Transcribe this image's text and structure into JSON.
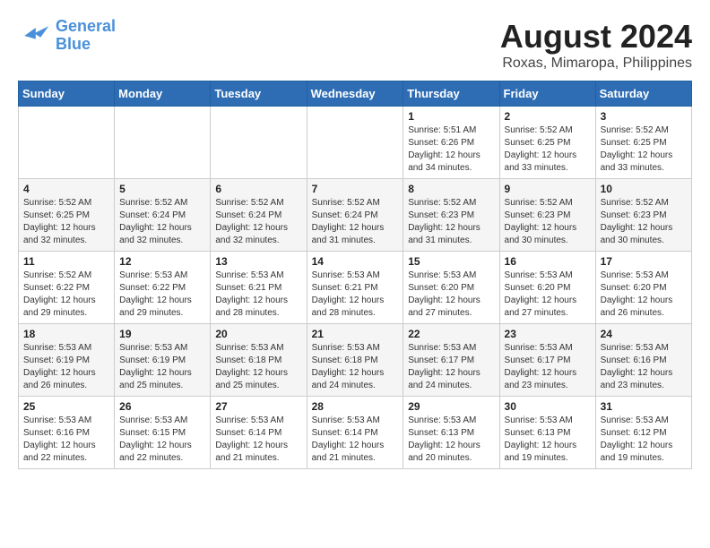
{
  "logo": {
    "line1": "General",
    "line2": "Blue"
  },
  "title": "August 2024",
  "subtitle": "Roxas, Mimaropa, Philippines",
  "days_of_week": [
    "Sunday",
    "Monday",
    "Tuesday",
    "Wednesday",
    "Thursday",
    "Friday",
    "Saturday"
  ],
  "weeks": [
    [
      {
        "day": "",
        "info": ""
      },
      {
        "day": "",
        "info": ""
      },
      {
        "day": "",
        "info": ""
      },
      {
        "day": "",
        "info": ""
      },
      {
        "day": "1",
        "info": "Sunrise: 5:51 AM\nSunset: 6:26 PM\nDaylight: 12 hours\nand 34 minutes."
      },
      {
        "day": "2",
        "info": "Sunrise: 5:52 AM\nSunset: 6:25 PM\nDaylight: 12 hours\nand 33 minutes."
      },
      {
        "day": "3",
        "info": "Sunrise: 5:52 AM\nSunset: 6:25 PM\nDaylight: 12 hours\nand 33 minutes."
      }
    ],
    [
      {
        "day": "4",
        "info": "Sunrise: 5:52 AM\nSunset: 6:25 PM\nDaylight: 12 hours\nand 32 minutes."
      },
      {
        "day": "5",
        "info": "Sunrise: 5:52 AM\nSunset: 6:24 PM\nDaylight: 12 hours\nand 32 minutes."
      },
      {
        "day": "6",
        "info": "Sunrise: 5:52 AM\nSunset: 6:24 PM\nDaylight: 12 hours\nand 32 minutes."
      },
      {
        "day": "7",
        "info": "Sunrise: 5:52 AM\nSunset: 6:24 PM\nDaylight: 12 hours\nand 31 minutes."
      },
      {
        "day": "8",
        "info": "Sunrise: 5:52 AM\nSunset: 6:23 PM\nDaylight: 12 hours\nand 31 minutes."
      },
      {
        "day": "9",
        "info": "Sunrise: 5:52 AM\nSunset: 6:23 PM\nDaylight: 12 hours\nand 30 minutes."
      },
      {
        "day": "10",
        "info": "Sunrise: 5:52 AM\nSunset: 6:23 PM\nDaylight: 12 hours\nand 30 minutes."
      }
    ],
    [
      {
        "day": "11",
        "info": "Sunrise: 5:52 AM\nSunset: 6:22 PM\nDaylight: 12 hours\nand 29 minutes."
      },
      {
        "day": "12",
        "info": "Sunrise: 5:53 AM\nSunset: 6:22 PM\nDaylight: 12 hours\nand 29 minutes."
      },
      {
        "day": "13",
        "info": "Sunrise: 5:53 AM\nSunset: 6:21 PM\nDaylight: 12 hours\nand 28 minutes."
      },
      {
        "day": "14",
        "info": "Sunrise: 5:53 AM\nSunset: 6:21 PM\nDaylight: 12 hours\nand 28 minutes."
      },
      {
        "day": "15",
        "info": "Sunrise: 5:53 AM\nSunset: 6:20 PM\nDaylight: 12 hours\nand 27 minutes."
      },
      {
        "day": "16",
        "info": "Sunrise: 5:53 AM\nSunset: 6:20 PM\nDaylight: 12 hours\nand 27 minutes."
      },
      {
        "day": "17",
        "info": "Sunrise: 5:53 AM\nSunset: 6:20 PM\nDaylight: 12 hours\nand 26 minutes."
      }
    ],
    [
      {
        "day": "18",
        "info": "Sunrise: 5:53 AM\nSunset: 6:19 PM\nDaylight: 12 hours\nand 26 minutes."
      },
      {
        "day": "19",
        "info": "Sunrise: 5:53 AM\nSunset: 6:19 PM\nDaylight: 12 hours\nand 25 minutes."
      },
      {
        "day": "20",
        "info": "Sunrise: 5:53 AM\nSunset: 6:18 PM\nDaylight: 12 hours\nand 25 minutes."
      },
      {
        "day": "21",
        "info": "Sunrise: 5:53 AM\nSunset: 6:18 PM\nDaylight: 12 hours\nand 24 minutes."
      },
      {
        "day": "22",
        "info": "Sunrise: 5:53 AM\nSunset: 6:17 PM\nDaylight: 12 hours\nand 24 minutes."
      },
      {
        "day": "23",
        "info": "Sunrise: 5:53 AM\nSunset: 6:17 PM\nDaylight: 12 hours\nand 23 minutes."
      },
      {
        "day": "24",
        "info": "Sunrise: 5:53 AM\nSunset: 6:16 PM\nDaylight: 12 hours\nand 23 minutes."
      }
    ],
    [
      {
        "day": "25",
        "info": "Sunrise: 5:53 AM\nSunset: 6:16 PM\nDaylight: 12 hours\nand 22 minutes."
      },
      {
        "day": "26",
        "info": "Sunrise: 5:53 AM\nSunset: 6:15 PM\nDaylight: 12 hours\nand 22 minutes."
      },
      {
        "day": "27",
        "info": "Sunrise: 5:53 AM\nSunset: 6:14 PM\nDaylight: 12 hours\nand 21 minutes."
      },
      {
        "day": "28",
        "info": "Sunrise: 5:53 AM\nSunset: 6:14 PM\nDaylight: 12 hours\nand 21 minutes."
      },
      {
        "day": "29",
        "info": "Sunrise: 5:53 AM\nSunset: 6:13 PM\nDaylight: 12 hours\nand 20 minutes."
      },
      {
        "day": "30",
        "info": "Sunrise: 5:53 AM\nSunset: 6:13 PM\nDaylight: 12 hours\nand 19 minutes."
      },
      {
        "day": "31",
        "info": "Sunrise: 5:53 AM\nSunset: 6:12 PM\nDaylight: 12 hours\nand 19 minutes."
      }
    ]
  ]
}
